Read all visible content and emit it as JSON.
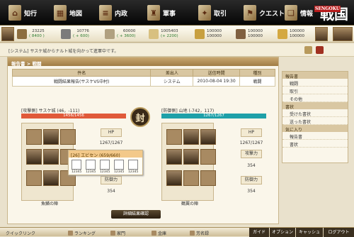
{
  "nav": {
    "items": [
      {
        "label": "知行",
        "icon": "mansion-icon"
      },
      {
        "label": "地図",
        "icon": "map-icon"
      },
      {
        "label": "内政",
        "icon": "scroll-icon"
      },
      {
        "label": "軍事",
        "icon": "helmet-icon"
      },
      {
        "label": "取引",
        "icon": "trade-icon"
      },
      {
        "label": "クエスト",
        "icon": "quest-icon"
      },
      {
        "label": "情報",
        "icon": "book-icon"
      }
    ],
    "logo": {
      "text": "戦国",
      "badge": "SENGOKU"
    }
  },
  "resources": [
    {
      "value": "23225",
      "sub": "( 8400 )",
      "icon": "wood-icon",
      "color": "#8d6e40"
    },
    {
      "value": "10776",
      "sub": "( + 600)",
      "icon": "stone-icon",
      "color": "#7b7b7b"
    },
    {
      "value": "60000",
      "sub": "( + 3600)",
      "icon": "iron-icon",
      "color": "#b0a080"
    },
    {
      "value": "1005403",
      "sub": "(+ 2200)",
      "icon": "rice-icon",
      "color": "#d8c080"
    },
    {
      "value": "100000",
      "sub": "100000",
      "icon": "coin-icon",
      "color": "#c8a040"
    },
    {
      "value": "100000",
      "sub": "100000",
      "icon": "card-icon",
      "color": "#806040"
    },
    {
      "value": "100000",
      "sub": "100000",
      "icon": "gold-icon",
      "color": "#d4a840"
    }
  ],
  "system": {
    "message": "[システム] サスケ城からナルト城を向かって進軍中です。"
  },
  "report": {
    "header": "報告書 > 戦闘",
    "columns": [
      "件名",
      "差出人",
      "送信時間",
      "種別"
    ],
    "row": {
      "subject": "戦闘結果報告(サスケVS中村)",
      "sender": "システム",
      "time": "2010-08-04 19:30",
      "type": "戦闘"
    },
    "attacker": {
      "label": "[攻撃側] サスケ城 (46，-111)",
      "hp_text": "1456/1456",
      "hp_fraction": 1.0,
      "formation": "魚鱗の陣"
    },
    "defender": {
      "label": "[防御側] 山地 (-742，117)",
      "hp_text": "1267/1267",
      "hp_fraction": 1.0,
      "formation": "鶴翼の陣"
    },
    "seal": "封",
    "stats": {
      "hp_label": "HP",
      "hp_value": "1267/1267",
      "atk_label": "攻撃力",
      "atk_value": "354",
      "def_label": "防御力",
      "def_value": "354"
    },
    "stats_left": {
      "hp_label": "HP",
      "hp_value": "1267/1267",
      "atk_label": "攻撃力",
      "atk_value": "354",
      "def_label": "防御力",
      "def_value": "354"
    },
    "popup": {
      "title": "[26] エビセン (659/660)",
      "slot": "12345"
    },
    "detail_button": "詳細結果確認"
  },
  "side": {
    "sections": [
      {
        "title": "報告書",
        "items": [
          "戦闘",
          "取引",
          "その他"
        ]
      },
      {
        "title": "書状",
        "items": [
          "受けた書状",
          "送った書状"
        ]
      },
      {
        "title": "気に入り",
        "items": [
          "報告書",
          "書状"
        ]
      }
    ]
  },
  "quick": {
    "title": "クイックリンク",
    "items": [
      "ランキング",
      "家門",
      "金庫",
      "芳名録"
    ],
    "right": [
      "ガイド",
      "オプション",
      "キャッシュ",
      "ログアウト"
    ]
  }
}
